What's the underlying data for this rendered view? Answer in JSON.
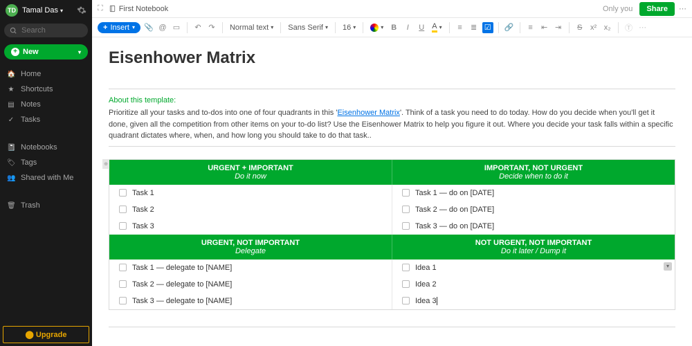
{
  "sidebar": {
    "user": "Tamal Das",
    "search_placeholder": "Search",
    "new_label": "New",
    "nav1": [
      {
        "icon": "home",
        "label": "Home"
      },
      {
        "icon": "star",
        "label": "Shortcuts"
      },
      {
        "icon": "note",
        "label": "Notes"
      },
      {
        "icon": "check",
        "label": "Tasks"
      }
    ],
    "nav2": [
      {
        "icon": "book",
        "label": "Notebooks"
      },
      {
        "icon": "tag",
        "label": "Tags"
      },
      {
        "icon": "people",
        "label": "Shared with Me"
      }
    ],
    "nav3": [
      {
        "icon": "trash",
        "label": "Trash"
      }
    ],
    "upgrade": "Upgrade"
  },
  "header": {
    "notebook": "First Notebook",
    "only_you": "Only you",
    "share": "Share"
  },
  "toolbar": {
    "insert": "Insert",
    "style": "Normal text",
    "font": "Sans Serif",
    "size": "16"
  },
  "note": {
    "title": "Eisenhower Matrix",
    "about": "About this template:",
    "desc_pre": "Prioritize all your tasks and to-dos into one of four quadrants in this '",
    "desc_link": "Eisenhower Matrix",
    "desc_post": "'. Think of a task you need to do today. How do you decide when you'll get it done, given all the competition from other items on your to-do list? Use the Eisenhower Matrix to help you figure it out. Where you decide your task falls within a specific quadrant dictates where, when, and how long you should take to do that task.."
  },
  "matrix": {
    "q1": {
      "title": "URGENT + IMPORTANT",
      "sub": "Do it now",
      "tasks": [
        "Task 1",
        "Task 2",
        "Task 3"
      ]
    },
    "q2": {
      "title": "IMPORTANT, NOT URGENT",
      "sub": "Decide when to do it",
      "tasks": [
        "Task 1 — do on [DATE]",
        "Task 2 — do on [DATE]",
        "Task 3 — do on [DATE]"
      ]
    },
    "q3": {
      "title": "URGENT, NOT IMPORTANT",
      "sub": "Delegate",
      "tasks": [
        "Task 1 — delegate to [NAME]",
        "Task 2 — delegate to [NAME]",
        "Task 3 — delegate to [NAME]"
      ]
    },
    "q4": {
      "title": "NOT URGENT, NOT IMPORTANT",
      "sub": "Do it later / Dump it",
      "tasks": [
        "Idea 1",
        "Idea 2",
        "Idea 3"
      ]
    }
  }
}
